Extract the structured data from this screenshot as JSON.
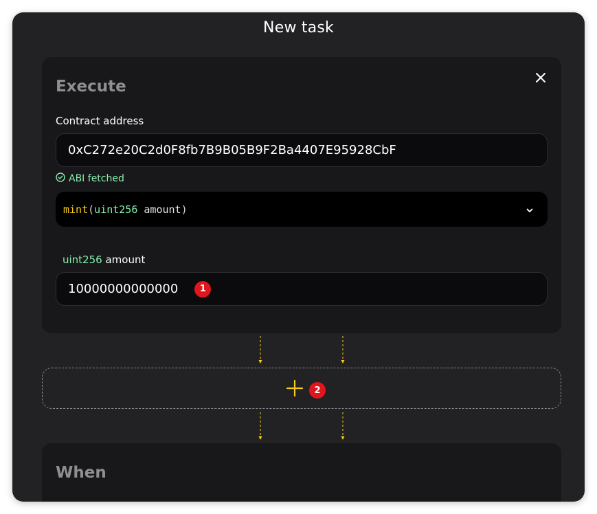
{
  "dialog": {
    "title": "New task"
  },
  "execute": {
    "heading": "Execute",
    "contract_label": "Contract address",
    "contract_address": "0xC272e20C2d0F8fb7B9B05B9F2Ba4407E95928CbF",
    "abi_status": "ABI fetched",
    "function_select": {
      "fn_name": "mint",
      "open_paren": "(",
      "param_type": "uint256",
      "param_name": " amount",
      "close_paren": ")"
    },
    "param": {
      "type": "uint256",
      "name": " amount",
      "value": "10000000000000",
      "badge": "1"
    },
    "close_icon": "close-icon",
    "chevron_icon": "chevron-down-icon",
    "check_icon": "check-circle-icon"
  },
  "add_step": {
    "icon": "plus-icon",
    "badge": "2"
  },
  "when": {
    "heading": "When"
  },
  "colors": {
    "accent_yellow": "#facc15",
    "success_green": "#86efac",
    "badge_red": "#e0161c",
    "background": "#222225",
    "card": "#18181b"
  }
}
